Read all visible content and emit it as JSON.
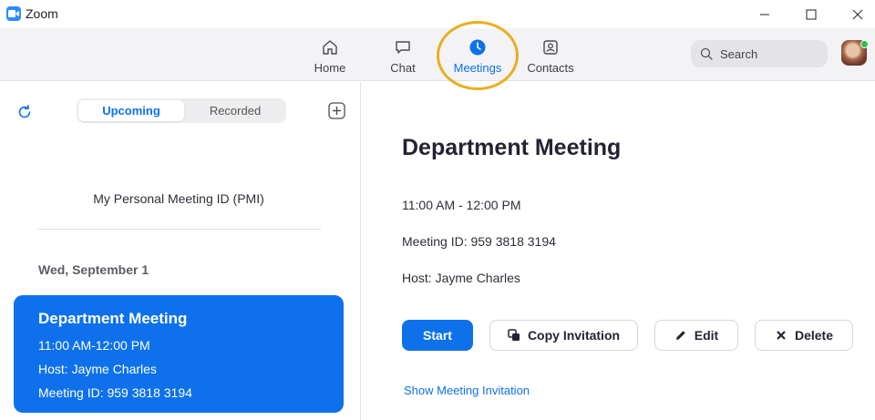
{
  "window": {
    "title": "Zoom"
  },
  "nav": {
    "tabs": [
      {
        "label": "Home",
        "icon": "home-icon"
      },
      {
        "label": "Chat",
        "icon": "chat-icon"
      },
      {
        "label": "Meetings",
        "icon": "clock-icon",
        "active": true
      },
      {
        "label": "Contacts",
        "icon": "contacts-icon"
      }
    ],
    "search_placeholder": "Search"
  },
  "colors": {
    "accent": "#0e71eb",
    "highlight_ring": "#e9ad21",
    "status_online": "#2ac145"
  },
  "sidebar": {
    "segments": [
      "Upcoming",
      "Recorded"
    ],
    "selected_segment": "Upcoming",
    "pmi_label": "My Personal Meeting ID (PMI)",
    "date_header": "Wed, September 1",
    "meeting_card": {
      "title": "Department Meeting",
      "time": "11:00 AM-12:00 PM",
      "host": "Host: Jayme Charles",
      "meeting_id": "Meeting ID: 959 3818 3194"
    }
  },
  "detail": {
    "title": "Department Meeting",
    "time": "11:00 AM - 12:00 PM",
    "meeting_id": "Meeting ID: 959 3818 3194",
    "host": "Host: Jayme Charles",
    "buttons": {
      "start": "Start",
      "copy": "Copy Invitation",
      "edit": "Edit",
      "delete": "Delete"
    },
    "show_invitation": "Show Meeting Invitation"
  }
}
